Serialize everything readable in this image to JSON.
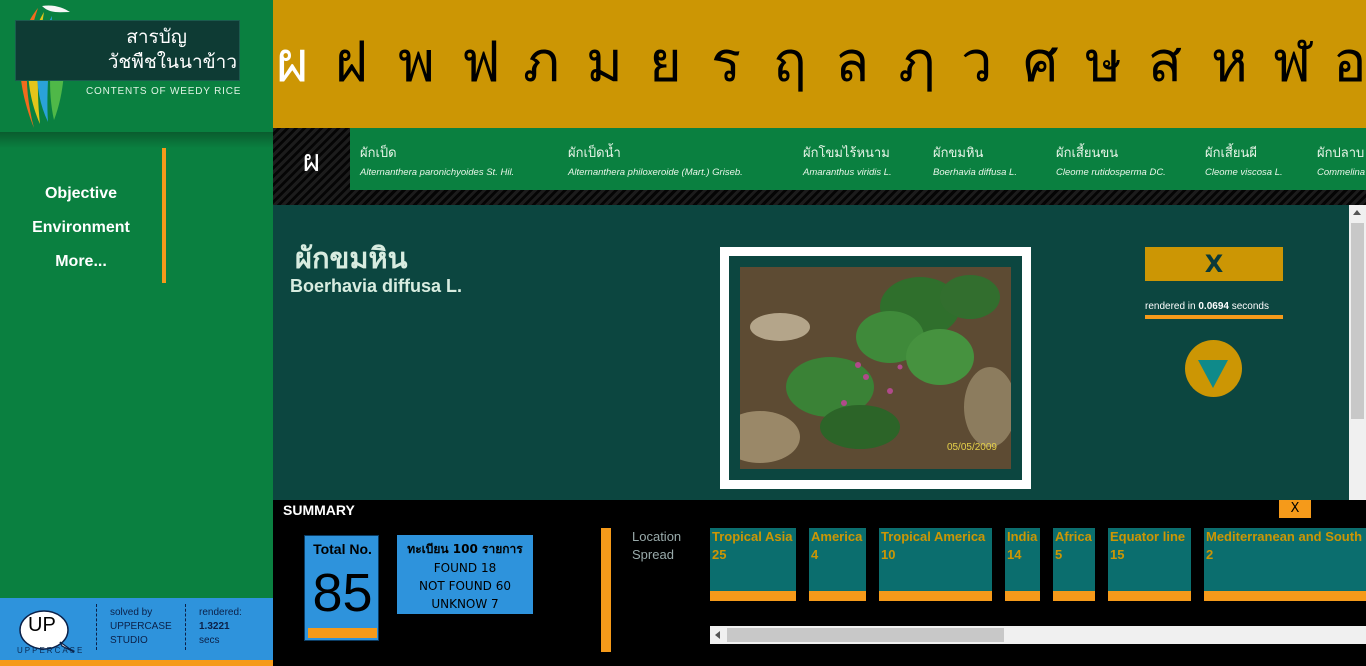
{
  "logo": {
    "title_line1": "สารบัญ",
    "title_line2": "วัชพืชในนาข้าว",
    "subtitle": "CONTENTS OF WEEDY RICE"
  },
  "menu": {
    "items": [
      "Objective",
      "Environment",
      "More..."
    ]
  },
  "footer": {
    "brand": "UP",
    "brand_sub": "UPPERCASE",
    "solved_by_line1": "solved by",
    "solved_by_line2": "UPPERCASE",
    "solved_by_line3": "STUDIO",
    "rendered_label": "rendered:",
    "rendered_value": "1.3221",
    "rendered_unit": "secs"
  },
  "alphabet": {
    "letters": [
      "ผ",
      "ฝ",
      "พ",
      "ฟ",
      "ภ",
      "ม",
      "ย",
      "ร",
      "ฤ",
      "ล",
      "ฦ",
      "ว",
      "ศ",
      "ษ",
      "ส",
      "ห",
      "ฬ",
      "อ"
    ],
    "active": "ผ"
  },
  "plant_strip": {
    "letter": "ผ",
    "tabs": [
      {
        "thai": "ผักเป็ด",
        "sci": "Alternanthera paronichyoides St. Hil."
      },
      {
        "thai": "ผักเป็ดน้ำ",
        "sci": "Alternanthera philoxeroide (Mart.) Griseb."
      },
      {
        "thai": "ผักโขมไร้หนาม",
        "sci": "Amaranthus viridis L."
      },
      {
        "thai": "ผักขมหิน",
        "sci": "Boerhavia diffusa L."
      },
      {
        "thai": "ผักเสี้ยนขน",
        "sci": "Cleome rutidosperma DC."
      },
      {
        "thai": "ผักเสี้ยนผี",
        "sci": "Cleome viscosa L."
      },
      {
        "thai": "ผักปลาบ",
        "sci": "Commelina"
      }
    ]
  },
  "detail": {
    "title": "ผักขมหิน",
    "scientific_name": "Boerhavia diffusa L.",
    "photo_date": "05/05/2009",
    "close_label": "X",
    "render_prefix": "rendered in ",
    "render_value": "0.0694",
    "render_suffix": " seconds"
  },
  "summary": {
    "label": "SUMMARY",
    "close_label": "X",
    "total_label": "Total No.",
    "total_value": "85",
    "found_title": "ทะเบียน 100 รายการ",
    "found_line": "FOUND  18",
    "not_found_line": "NOT FOUND  60",
    "unknown_line": "UNKNOW  7",
    "location_label_1": "Location",
    "location_label_2": "Spread",
    "regions": [
      {
        "name": "Tropical Asia",
        "count": "25"
      },
      {
        "name": "America",
        "count": "4"
      },
      {
        "name": "Tropical America",
        "count": "10"
      },
      {
        "name": "India",
        "count": "14"
      },
      {
        "name": "Africa",
        "count": "5"
      },
      {
        "name": "Equator line",
        "count": "15"
      },
      {
        "name": "Mediterranean and South",
        "count": "2"
      }
    ]
  },
  "colors": {
    "sidebar_green": "#0a8040",
    "alphabet_gold": "#cc9604",
    "accent_orange": "#f59a1a",
    "detail_teal": "#0c4640",
    "footer_blue": "#2e93dc"
  }
}
